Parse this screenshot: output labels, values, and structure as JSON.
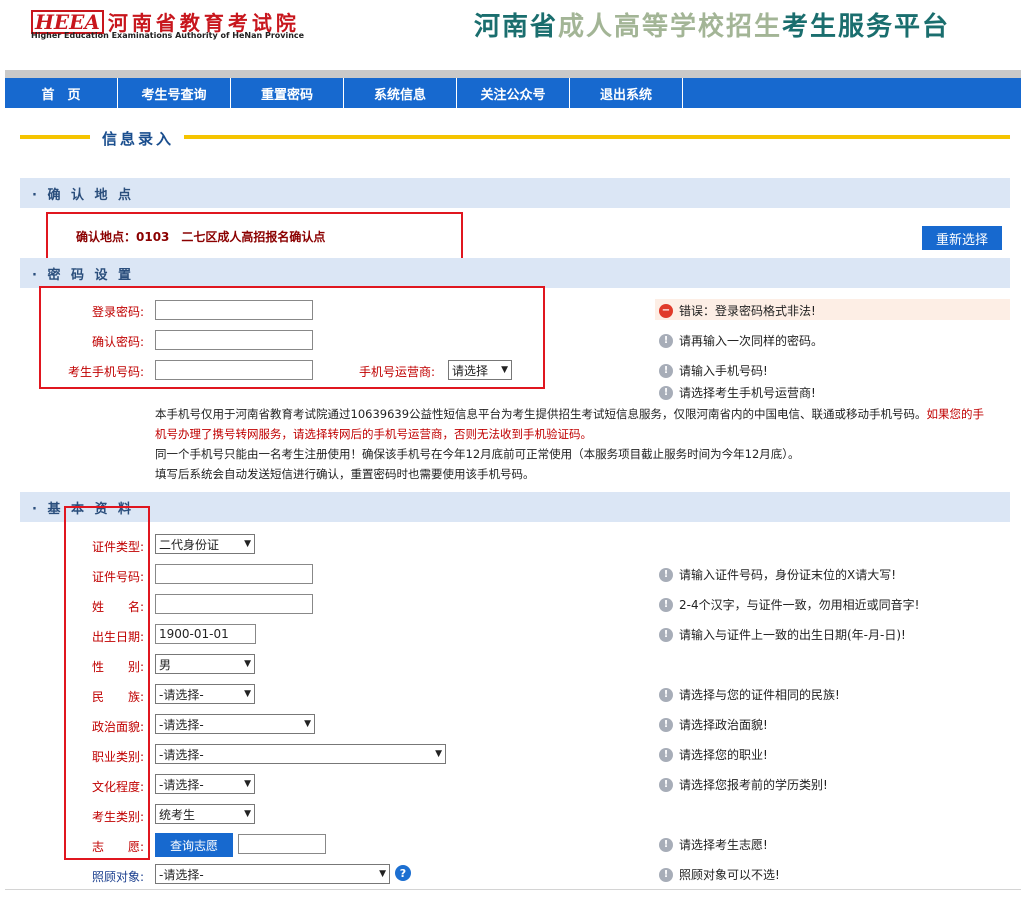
{
  "header": {
    "logo_mark": "HEEA",
    "logo_cn": "河南省教育考试院",
    "logo_en": "Higher Education Examinations Authority of HeNan Province",
    "title_part1": "河南省",
    "title_part2": "成人高等学校招生",
    "title_part3": "考生服务平台",
    "accent": "#1a6e6e",
    "accent2": "#9aae8a"
  },
  "nav": [
    "首　页",
    "考生号查询",
    "重置密码",
    "系统信息",
    "关注公众号",
    "退出系统"
  ],
  "page_title": "信息录入",
  "sections": {
    "confirm": "· 确 认 地 点",
    "password": "· 密 码 设 置",
    "basic": "· 基 本 资 料"
  },
  "confirm": {
    "text": "确认地点：0103　二七区成人高招报名确认点",
    "reselect_button": "重新选择"
  },
  "password": {
    "login_label": "登录密码:",
    "confirm_label": "确认密码:",
    "phone_label": "考生手机号码:",
    "carrier_label": "手机号运营商:",
    "carrier_value": "请选择",
    "hint_error": "错误：登录密码格式非法!",
    "hint_confirm": "请再输入一次同样的密码。",
    "hint_phone": "请输入手机号码!",
    "hint_carrier": "请选择考生手机号运营商!"
  },
  "notice": {
    "line1_black": "本手机号仅用于河南省教育考试院通过10639639公益性短信息平台为考生提供招生考试短信息服务，仅限河南省内的中国电信、联通或移动手机号码。",
    "line1_red": "如果您的手",
    "line2_red": "机号办理了携号转网服务，请选择转网后的手机号运营商，否则无法收到手机验证码。",
    "line3": "同一个手机号只能由一名考生注册使用！确保该手机号在今年12月底前可正常使用（本服务项目截止服务时间为今年12月底）。",
    "line4": "填写后系统会自动发送短信进行确认，重置密码时也需要使用该手机号码。"
  },
  "basic": {
    "id_type_label": "证件类型:",
    "id_type_value": "二代身份证",
    "id_no_label": "证件号码:",
    "name_label": "姓　　名:",
    "birth_label": "出生日期:",
    "birth_value": "1900-01-01",
    "gender_label": "性　　别:",
    "gender_value": "男",
    "nation_label": "民　　族:",
    "nation_value": "-请选择-",
    "politics_label": "政治面貌:",
    "politics_value": "-请选择-",
    "job_label": "职业类别:",
    "job_value": "-请选择-",
    "edu_label": "文化程度:",
    "edu_value": "-请选择-",
    "cand_label": "考生类别:",
    "cand_value": "统考生",
    "wish_label": "志　　愿:",
    "wish_button": "查询志愿",
    "care_label": "照顾对象:",
    "care_value": "-请选择-",
    "hint_id": "请输入证件号码，身份证末位的X请大写!",
    "hint_name": "2-4个汉字，与证件一致，勿用相近或同音字!",
    "hint_birth": "请输入与证件上一致的出生日期(年-月-日)!",
    "hint_nation": "请选择与您的证件相同的民族!",
    "hint_politics": "请选择政治面貌!",
    "hint_job": "请选择您的职业!",
    "hint_edu": "请选择您报考前的学历类别!",
    "hint_wish": "请选择考生志愿!",
    "hint_care": "照顾对象可以不选!"
  },
  "icons": {
    "info": "info-icon",
    "error": "error-icon",
    "help": "question-icon"
  }
}
